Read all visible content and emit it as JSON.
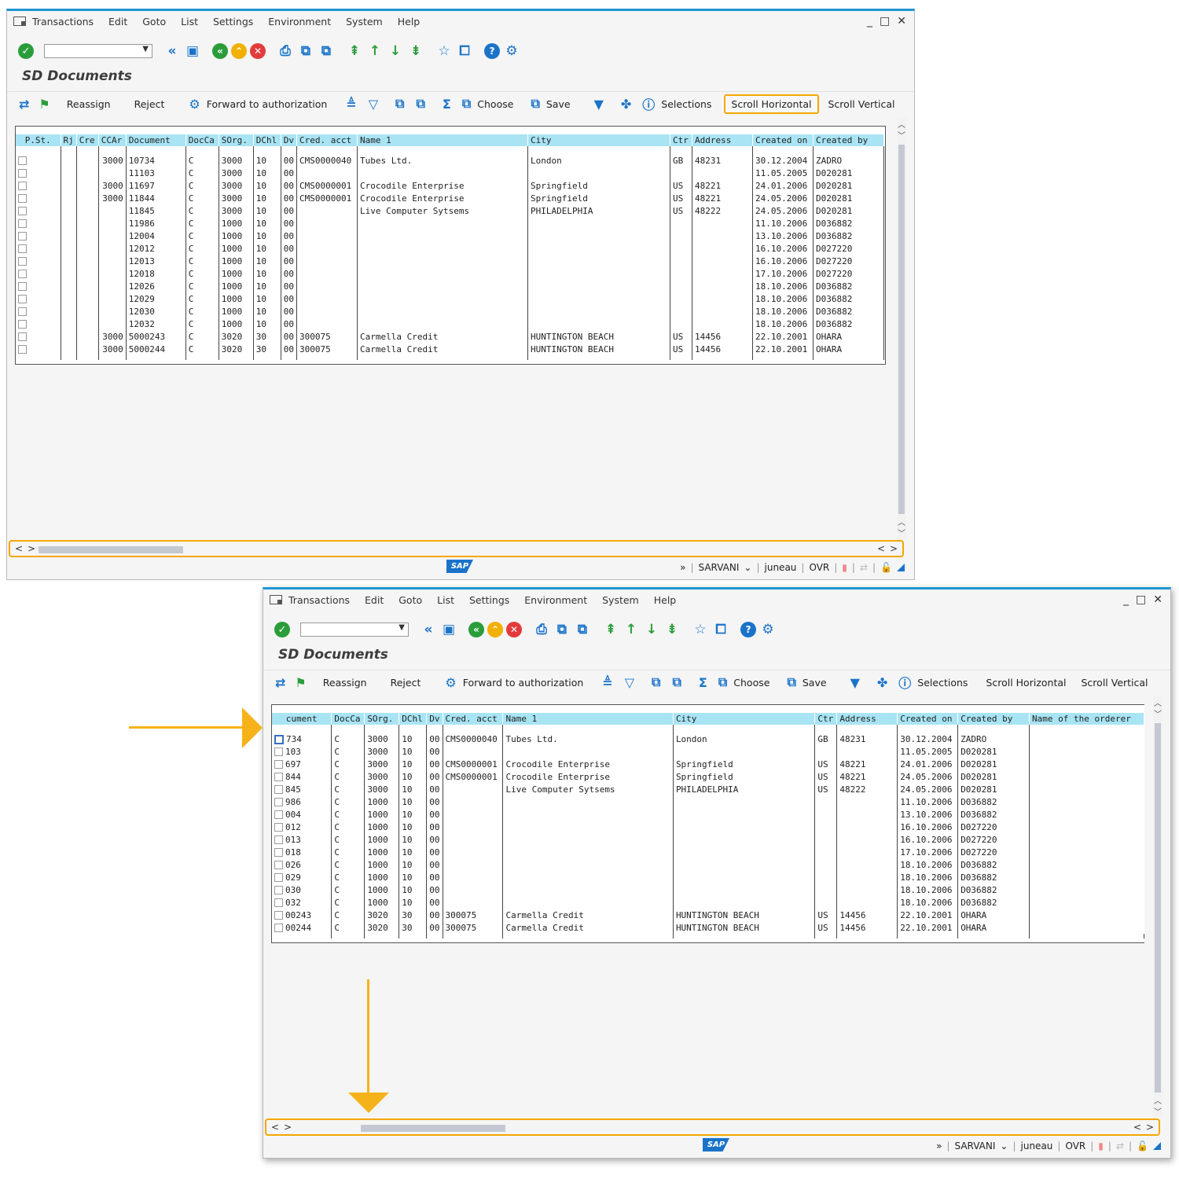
{
  "menu": [
    "Transactions",
    "Edit",
    "Goto",
    "List",
    "Settings",
    "Environment",
    "System",
    "Help"
  ],
  "window_controls": [
    "_",
    "□",
    "✕"
  ],
  "page_title": "SD Documents",
  "app_toolbar": {
    "reassign": "Reassign",
    "reject": "Reject",
    "forward": "Forward to authorization",
    "choose": "Choose",
    "save": "Save",
    "selections": "Selections",
    "scroll_horizontal": "Scroll Horizontal",
    "scroll_vertical": "Scroll Vertical"
  },
  "status": {
    "system": "SARVANI",
    "client": "juneau",
    "mode": "OVR",
    "logo": "SAP"
  },
  "grid1": {
    "headers": [
      "P.St.",
      "Rj",
      "Cre",
      "CCAr",
      "Document",
      "DocCa",
      "SOrg.",
      "DChl",
      "Dv",
      "Cred. acct",
      "Name 1",
      "City",
      "Ctr",
      "Address",
      "Created on",
      "Created by"
    ],
    "rows": [
      [
        "",
        "",
        "",
        "3000",
        "10734",
        "C",
        "3000",
        "10",
        "00",
        "CMS0000040",
        "Tubes Ltd.",
        "London",
        "GB",
        "48231",
        "30.12.2004",
        "ZADRO"
      ],
      [
        "",
        "",
        "",
        "",
        "11103",
        "C",
        "3000",
        "10",
        "00",
        "",
        "",
        "",
        "",
        "",
        "11.05.2005",
        "D020281"
      ],
      [
        "",
        "",
        "",
        "3000",
        "11697",
        "C",
        "3000",
        "10",
        "00",
        "CMS0000001",
        "Crocodile Enterprise",
        "Springfield",
        "US",
        "48221",
        "24.01.2006",
        "D020281"
      ],
      [
        "",
        "",
        "",
        "3000",
        "11844",
        "C",
        "3000",
        "10",
        "00",
        "CMS0000001",
        "Crocodile Enterprise",
        "Springfield",
        "US",
        "48221",
        "24.05.2006",
        "D020281"
      ],
      [
        "",
        "",
        "",
        "",
        "11845",
        "C",
        "3000",
        "10",
        "00",
        "",
        "Live Computer Sytsems",
        "PHILADELPHIA",
        "US",
        "48222",
        "24.05.2006",
        "D020281"
      ],
      [
        "",
        "",
        "",
        "",
        "11986",
        "C",
        "1000",
        "10",
        "00",
        "",
        "",
        "",
        "",
        "",
        "11.10.2006",
        "D036882"
      ],
      [
        "",
        "",
        "",
        "",
        "12004",
        "C",
        "1000",
        "10",
        "00",
        "",
        "",
        "",
        "",
        "",
        "13.10.2006",
        "D036882"
      ],
      [
        "",
        "",
        "",
        "",
        "12012",
        "C",
        "1000",
        "10",
        "00",
        "",
        "",
        "",
        "",
        "",
        "16.10.2006",
        "D027220"
      ],
      [
        "",
        "",
        "",
        "",
        "12013",
        "C",
        "1000",
        "10",
        "00",
        "",
        "",
        "",
        "",
        "",
        "16.10.2006",
        "D027220"
      ],
      [
        "",
        "",
        "",
        "",
        "12018",
        "C",
        "1000",
        "10",
        "00",
        "",
        "",
        "",
        "",
        "",
        "17.10.2006",
        "D027220"
      ],
      [
        "",
        "",
        "",
        "",
        "12026",
        "C",
        "1000",
        "10",
        "00",
        "",
        "",
        "",
        "",
        "",
        "18.10.2006",
        "D036882"
      ],
      [
        "",
        "",
        "",
        "",
        "12029",
        "C",
        "1000",
        "10",
        "00",
        "",
        "",
        "",
        "",
        "",
        "18.10.2006",
        "D036882"
      ],
      [
        "",
        "",
        "",
        "",
        "12030",
        "C",
        "1000",
        "10",
        "00",
        "",
        "",
        "",
        "",
        "",
        "18.10.2006",
        "D036882"
      ],
      [
        "",
        "",
        "",
        "",
        "12032",
        "C",
        "1000",
        "10",
        "00",
        "",
        "",
        "",
        "",
        "",
        "18.10.2006",
        "D036882"
      ],
      [
        "",
        "",
        "",
        "3000",
        "5000243",
        "C",
        "3020",
        "30",
        "00",
        "300075",
        "Carmella Credit",
        "HUNTINGTON BEACH",
        "US",
        "14456",
        "22.10.2001",
        "OHARA"
      ],
      [
        "",
        "",
        "",
        "3000",
        "5000244",
        "C",
        "3020",
        "30",
        "00",
        "300075",
        "Carmella Credit",
        "HUNTINGTON BEACH",
        "US",
        "14456",
        "22.10.2001",
        "OHARA"
      ]
    ]
  },
  "grid2": {
    "headers": [
      "cument",
      "DocCa",
      "SOrg.",
      "DChl",
      "Dv",
      "Cred. acct",
      "Name 1",
      "City",
      "Ctr",
      "Address",
      "Created on",
      "Created by",
      "Name of the orderer"
    ],
    "rows": [
      [
        "734",
        "C",
        "3000",
        "10",
        "00",
        "CMS0000040",
        "Tubes Ltd.",
        "London",
        "GB",
        "48231",
        "30.12.2004",
        "ZADRO",
        ""
      ],
      [
        "103",
        "C",
        "3000",
        "10",
        "00",
        "",
        "",
        "",
        "",
        "",
        "11.05.2005",
        "D020281",
        ""
      ],
      [
        "697",
        "C",
        "3000",
        "10",
        "00",
        "CMS0000001",
        "Crocodile Enterprise",
        "Springfield",
        "US",
        "48221",
        "24.01.2006",
        "D020281",
        ""
      ],
      [
        "844",
        "C",
        "3000",
        "10",
        "00",
        "CMS0000001",
        "Crocodile Enterprise",
        "Springfield",
        "US",
        "48221",
        "24.05.2006",
        "D020281",
        ""
      ],
      [
        "845",
        "C",
        "3000",
        "10",
        "00",
        "",
        "Live Computer Sytsems",
        "PHILADELPHIA",
        "US",
        "48222",
        "24.05.2006",
        "D020281",
        ""
      ],
      [
        "986",
        "C",
        "1000",
        "10",
        "00",
        "",
        "",
        "",
        "",
        "",
        "11.10.2006",
        "D036882",
        ""
      ],
      [
        "004",
        "C",
        "1000",
        "10",
        "00",
        "",
        "",
        "",
        "",
        "",
        "13.10.2006",
        "D036882",
        ""
      ],
      [
        "012",
        "C",
        "1000",
        "10",
        "00",
        "",
        "",
        "",
        "",
        "",
        "16.10.2006",
        "D027220",
        ""
      ],
      [
        "013",
        "C",
        "1000",
        "10",
        "00",
        "",
        "",
        "",
        "",
        "",
        "16.10.2006",
        "D027220",
        ""
      ],
      [
        "018",
        "C",
        "1000",
        "10",
        "00",
        "",
        "",
        "",
        "",
        "",
        "17.10.2006",
        "D027220",
        ""
      ],
      [
        "026",
        "C",
        "1000",
        "10",
        "00",
        "",
        "",
        "",
        "",
        "",
        "18.10.2006",
        "D036882",
        ""
      ],
      [
        "029",
        "C",
        "1000",
        "10",
        "00",
        "",
        "",
        "",
        "",
        "",
        "18.10.2006",
        "D036882",
        ""
      ],
      [
        "030",
        "C",
        "1000",
        "10",
        "00",
        "",
        "",
        "",
        "",
        "",
        "18.10.2006",
        "D036882",
        ""
      ],
      [
        "032",
        "C",
        "1000",
        "10",
        "00",
        "",
        "",
        "",
        "",
        "",
        "18.10.2006",
        "D036882",
        ""
      ],
      [
        "00243",
        "C",
        "3020",
        "30",
        "00",
        "300075",
        "Carmella Credit",
        "HUNTINGTON BEACH",
        "US",
        "14456",
        "22.10.2001",
        "OHARA",
        ""
      ],
      [
        "00244",
        "C",
        "3020",
        "30",
        "00",
        "300075",
        "Carmella Credit",
        "HUNTINGTON BEACH",
        "US",
        "14456",
        "22.10.2001",
        "OHARA",
        ""
      ]
    ]
  },
  "colors": {
    "accent": "#f5a700",
    "header_bg": "#a8e4f4",
    "window_top": "#1e96d2"
  }
}
